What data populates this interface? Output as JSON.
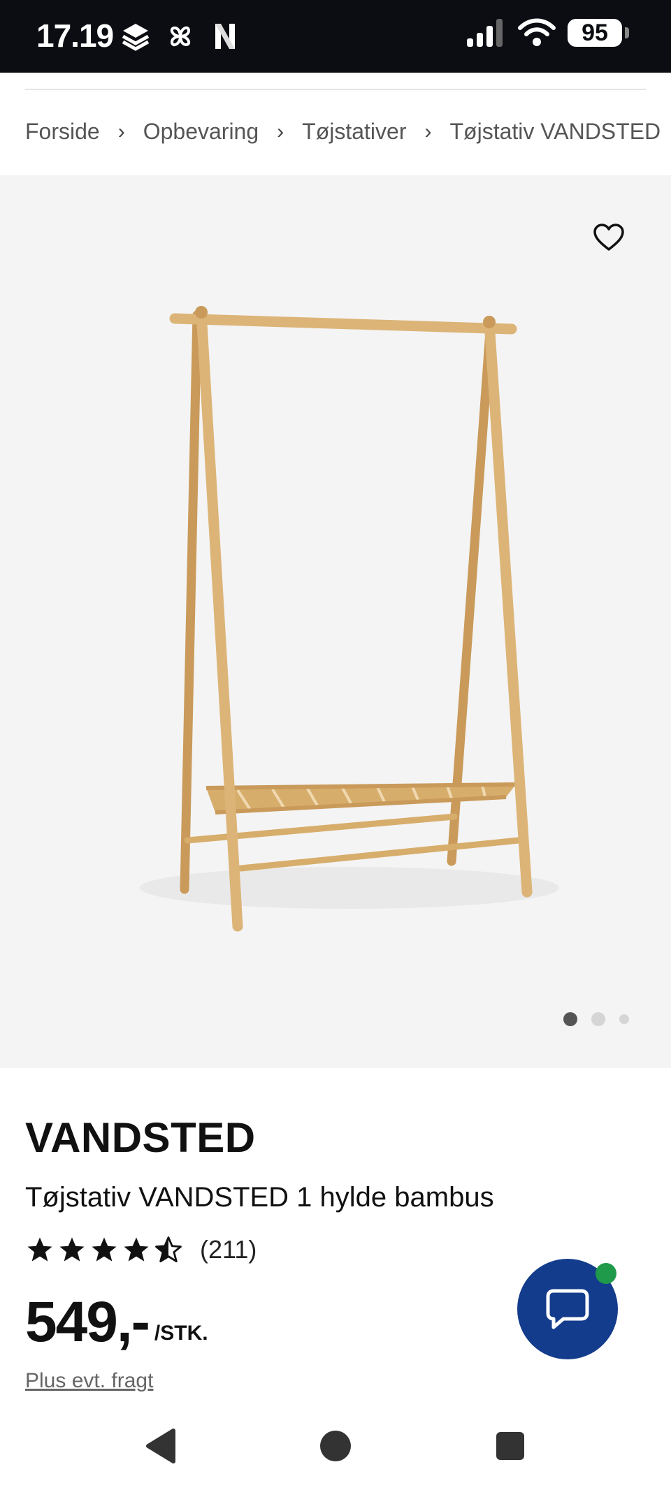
{
  "status_bar": {
    "time": "17.19",
    "battery": "95",
    "icons": [
      "stacked-layers-icon",
      "pinwheel-icon",
      "netflix-icon",
      "signal-icon",
      "wifi-icon",
      "battery-icon"
    ]
  },
  "breadcrumb": {
    "items": [
      "Forside",
      "Opbevaring",
      "Tøjstativer",
      "Tøjstativ VANDSTED"
    ],
    "separator": "›"
  },
  "gallery": {
    "image_alt": "bamboo-clothes-rack",
    "total_images": 3,
    "active_index": 0,
    "favorite_icon": "heart-icon"
  },
  "product": {
    "brand": "VANDSTED",
    "name": "Tøjstativ VANDSTED 1 hylde bambus",
    "rating_value": 4.5,
    "rating_count": "(211)",
    "price": "549,-",
    "unit": "/STK.",
    "shipping_note": "Plus evt. fragt"
  },
  "chat": {
    "icon": "chat-bubble-icon",
    "status": "online"
  },
  "colors": {
    "status_bar_bg": "#0b0d12",
    "hero_bg": "#f4f4f4",
    "chat_bg": "#143c8c",
    "online_dot": "#1f9a4a",
    "bamboo": "#dcb477"
  },
  "nav": {
    "buttons": [
      "back-icon",
      "home-icon",
      "recents-icon"
    ]
  }
}
